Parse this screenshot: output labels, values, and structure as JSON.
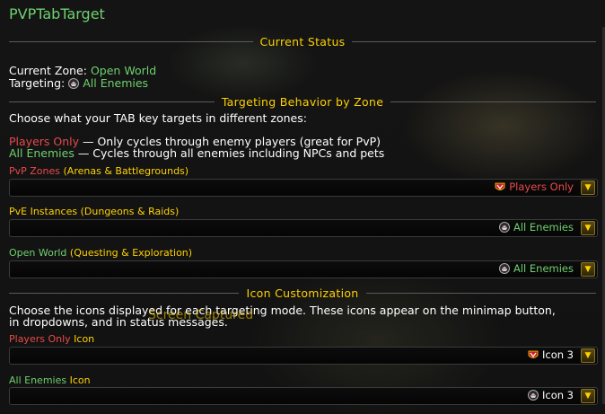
{
  "window": {
    "title": "PVPTabTarget"
  },
  "sections": {
    "current_status": "Current Status",
    "targeting_behavior": "Targeting Behavior by Zone",
    "icon_customization": "Icon Customization"
  },
  "status": {
    "zone_label": "Current Zone:",
    "zone_value": "Open World",
    "targeting_label": "Targeting:",
    "targeting_value": "All Enemies"
  },
  "behavior": {
    "intro": "Choose what your TAB key targets in different zones:",
    "players_only_name": "Players Only",
    "players_only_desc": "— Only cycles through enemy players (great for PvP)",
    "all_enemies_name": "All Enemies",
    "all_enemies_desc": "— Cycles through all enemies including NPCs and pets"
  },
  "zones": {
    "pvp": {
      "label_name": "PvP Zones",
      "label_detail": "(Arenas & Battlegrounds)",
      "value": "Players Only",
      "icon": "horde-crest-icon"
    },
    "pve": {
      "label_name": "PvE Instances",
      "label_detail": "(Dungeons & Raids)",
      "value": "All Enemies",
      "icon": "skull-helm-icon"
    },
    "world": {
      "label_name": "Open World",
      "label_detail": "(Questing & Exploration)",
      "value": "All Enemies",
      "icon": "skull-helm-icon"
    }
  },
  "icons": {
    "intro_line1": "Choose the icons displayed for each targeting mode. These icons appear on the minimap button,",
    "intro_line2": "in dropdowns, and in status messages.",
    "players_only_name": "Players Only",
    "players_only_suffix": "Icon",
    "players_only_value": "Icon 3",
    "all_enemies_name": "All Enemies",
    "all_enemies_suffix": "Icon",
    "all_enemies_value": "Icon 3"
  },
  "overlay_text": "Screen Captured",
  "colors": {
    "green": "#6fd06f",
    "red": "#e84a4a",
    "gold": "#ffd100",
    "white": "#ffffff"
  }
}
